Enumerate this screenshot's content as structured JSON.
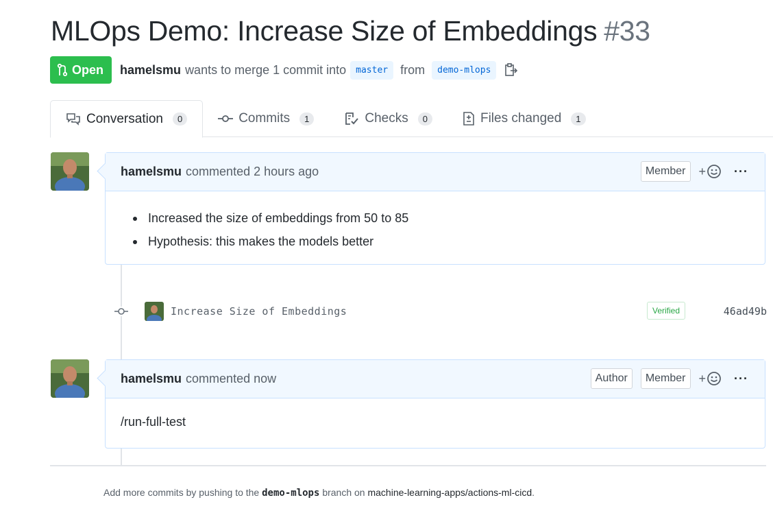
{
  "pr": {
    "title": "MLOps Demo: Increase Size of Embeddings",
    "number": "#33",
    "state": "Open",
    "author": "hamelsmu",
    "merge_text": "wants to merge 1 commit into",
    "base_branch": "master",
    "from_text": "from",
    "head_branch": "demo-mlops"
  },
  "tabs": [
    {
      "label": "Conversation",
      "count": "0",
      "icon": "comment-discussion-icon"
    },
    {
      "label": "Commits",
      "count": "1",
      "icon": "git-commit-icon"
    },
    {
      "label": "Checks",
      "count": "0",
      "icon": "checklist-icon"
    },
    {
      "label": "Files changed",
      "count": "1",
      "icon": "file-diff-icon"
    }
  ],
  "comments": [
    {
      "author": "hamelsmu",
      "action": "commented 2 hours ago",
      "badges": [
        "Member"
      ],
      "bullets": [
        "Increased the size of embeddings from 50 to 85",
        "Hypothesis: this makes the models better"
      ]
    },
    {
      "author": "hamelsmu",
      "action": "commented now",
      "badges": [
        "Author",
        "Member"
      ],
      "body": "/run-full-test"
    }
  ],
  "commit": {
    "message": "Increase Size of Embeddings",
    "verified": "Verified",
    "sha": "46ad49b"
  },
  "footer": {
    "prefix": "Add more commits by pushing to the",
    "branch": "demo-mlops",
    "middle": "branch on",
    "repo": "machine-learning-apps/actions-ml-cicd",
    "suffix": "."
  },
  "colors": {
    "open_green": "#2cbe4e",
    "comment_header": "#f1f8ff",
    "link_blue": "#0366d6"
  }
}
